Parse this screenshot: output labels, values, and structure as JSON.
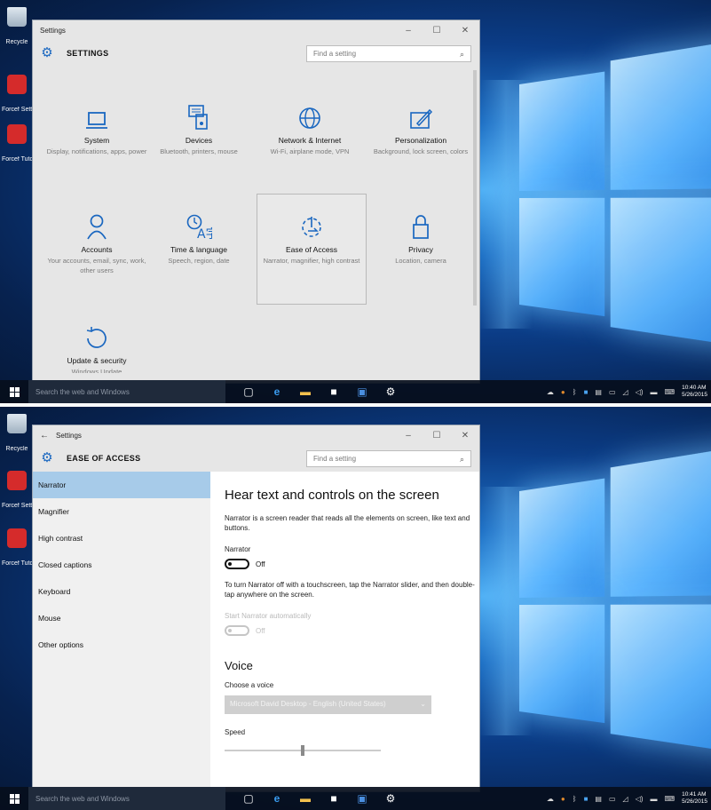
{
  "desktop": {
    "icons": [
      {
        "label": "Recycle"
      },
      {
        "label": "Forcef Settin"
      },
      {
        "label": "Forcef Tutor"
      }
    ]
  },
  "screen1": {
    "window_title": "Settings",
    "header_title": "SETTINGS",
    "search_placeholder": "Find a setting",
    "categories": [
      {
        "name": "System",
        "desc": "Display, notifications, apps, power",
        "icon": "laptop-icon"
      },
      {
        "name": "Devices",
        "desc": "Bluetooth, printers, mouse",
        "icon": "keyboard-icon"
      },
      {
        "name": "Network & Internet",
        "desc": "Wi-Fi, airplane mode, VPN",
        "icon": "globe-icon"
      },
      {
        "name": "Personalization",
        "desc": "Background, lock screen, colors",
        "icon": "paint-icon"
      },
      {
        "name": "Accounts",
        "desc": "Your accounts, email, sync, work, other users",
        "icon": "person-icon"
      },
      {
        "name": "Time & language",
        "desc": "Speech, region, date",
        "icon": "language-icon"
      },
      {
        "name": "Ease of Access",
        "desc": "Narrator, magnifier, high contrast",
        "icon": "ease-of-access-icon"
      },
      {
        "name": "Privacy",
        "desc": "Location, camera",
        "icon": "lock-icon"
      },
      {
        "name": "Update & security",
        "desc": "Windows Update",
        "icon": "refresh-icon"
      }
    ],
    "taskbar": {
      "search_placeholder": "Search the web and Windows",
      "time": "10:40 AM",
      "date": "5/26/2015"
    }
  },
  "screen2": {
    "window_title": "Settings",
    "header_title": "EASE OF ACCESS",
    "search_placeholder": "Find a setting",
    "nav": [
      "Narrator",
      "Magnifier",
      "High contrast",
      "Closed captions",
      "Keyboard",
      "Mouse",
      "Other options"
    ],
    "content": {
      "heading": "Hear text and controls on the screen",
      "intro": "Narrator is a screen reader that reads all the elements on screen, like text and buttons.",
      "narrator_label": "Narrator",
      "narrator_state": "Off",
      "touch_note": "To turn Narrator off with a touchscreen, tap the Narrator slider, and then double-tap anywhere on the screen.",
      "start_auto_label": "Start Narrator automatically",
      "start_auto_state": "Off",
      "voice_heading": "Voice",
      "choose_voice_label": "Choose a voice",
      "voice_value": "Microsoft David Desktop - English (United States)",
      "speed_label": "Speed",
      "speed_level": 0.5
    },
    "taskbar": {
      "search_placeholder": "Search the web and Windows",
      "time": "10:41 AM",
      "date": "5/26/2015"
    }
  },
  "colors": {
    "accent": "#1a67c0",
    "nav_active": "#a7cbe9"
  }
}
